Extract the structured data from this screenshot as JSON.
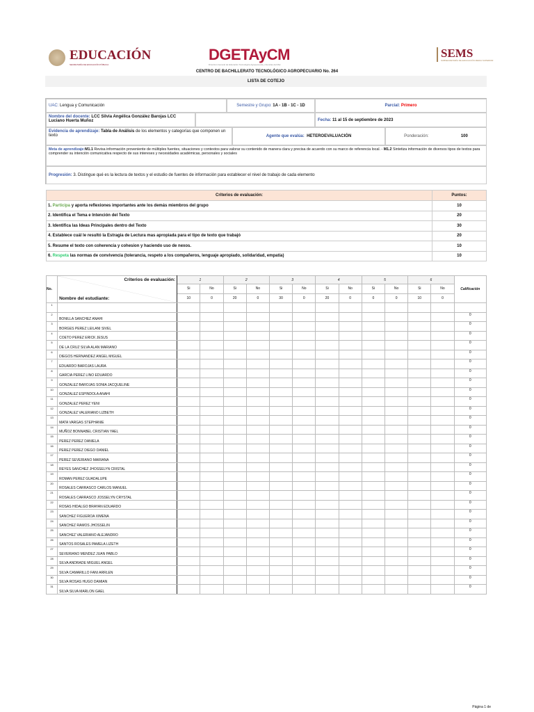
{
  "header": {
    "logo_left": "EDUCACIÓN",
    "logo_left_sub": "SECRETARÍA DE EDUCACIÓN PÚBLICA",
    "logo_center": "DGETAyCM",
    "logo_center_sub": "Dirección General de Educación Tecnológica Agropecuaria y Ciencias del Mar",
    "logo_right": "SEMS",
    "logo_right_sub": "SUBSECRETARÍA DE EDUCACIÓN MEDIA SUPERIOR",
    "school": "CENTRO DE BACHILLERATO TECNOLÓGICO AGROPECUARIO No. 264",
    "doc_title": "LISTA DE COTEJO"
  },
  "info": {
    "uac_label": "UAC:",
    "uac": "Lengua y Comunicación",
    "semestre_label": "Semestre y Grupo:",
    "semestre": "1A - 1B - 1C - 1D",
    "parcial_label": "Parcial:",
    "parcial": "Primero",
    "docente_label": "Nombre del docente:",
    "docente": "LCC Silvia Angélica González Barojas LCC Luciano Huerta Muñoz",
    "fecha_label": "Fecha:",
    "fecha": "11 al 15 de septiembre de 2023",
    "evidencia_label": "Evidencia de aprendizaje:",
    "evidencia_bold": "Tabla de Análisis",
    "evidencia": " de los elementos y categorías que componen un texto",
    "agente_label": "Agente que evalúa:",
    "agente": "HETEROEVALUACIÓN",
    "ponderacion_label": "Ponderación:",
    "ponderacion": "100",
    "meta_label": "Meta de aprendizaje:",
    "meta_m1": "M1.1",
    "meta_text1": " Revisa información proveniente de múltiples fuentes, situaciones y contextos para valorar su contenido de manera clara y precisa de acuerdo con su marco de referencia local. - ",
    "meta_m2": "M1.2",
    "meta_text2": " Sintetiza información de diversos tipos de textos para comprender su intención comunicativa respecto de sus intereses y necesidades académicas, personales y sociales",
    "progresion_label": "Progresión:",
    "progresion": "3. Distingue qué es la lectura de textos y el estudio de fuentes de información para establecer el nivel de trabajo de cada elemento"
  },
  "criteria": {
    "header": "Criterios de evaluación:",
    "points_header": "Puntos:",
    "items": [
      {
        "num": "1. ",
        "hl": "Participa",
        "text": " y aporta reflexiones importantes ante los demás miembros del grupo",
        "points": "10"
      },
      {
        "num": "",
        "hl": "",
        "text": "2. Identifica el Tema e Intención del Texto",
        "points": "20"
      },
      {
        "num": "",
        "hl": "",
        "text": "3. Identifica las Ideas Principales dentro del Texto",
        "points": "30"
      },
      {
        "num": "",
        "hl": "",
        "text": "4. Establece cuál le resultó la Estragia de Lectura mas apropiada para el tipo de texto que trabajó",
        "points": "20"
      },
      {
        "num": "",
        "hl": "",
        "text": "5. Resume el texto con coherencia y cohesion y haciendo uso de nexos.",
        "points": "10"
      },
      {
        "num": "6. ",
        "hl": "Respeta",
        "text": " las normas de convivencia (tolerancia, respeto a los compañeros, lenguaje apropiado, solidaridad, empatía)",
        "points": "10"
      }
    ]
  },
  "grid": {
    "no_header": "No.",
    "criteria_header": "Criterios de evaluación:",
    "student_header": "Nombre del estudiante:",
    "grade_header": "Calificación",
    "groups": [
      "1",
      "2",
      "3",
      "4",
      "5",
      "6"
    ],
    "si": "Si",
    "no": "No",
    "weights": [
      "10",
      "0",
      "20",
      "0",
      "30",
      "0",
      "20",
      "0",
      "0",
      "0",
      "10",
      "0"
    ],
    "students": [
      {
        "n": "1",
        "name": "",
        "grade": ""
      },
      {
        "n": "2",
        "name": "BONILLA SANCHEZ ANAHI",
        "grade": "0"
      },
      {
        "n": "3",
        "name": "BORGES PEREZ LEILANI SIVEL",
        "grade": "0"
      },
      {
        "n": "4",
        "name": "COETO PEREZ ERICK JESUS",
        "grade": "0"
      },
      {
        "n": "5",
        "name": "DE LA CRUZ SILVA ALAN MARIANO",
        "grade": "0"
      },
      {
        "n": "6",
        "name": "DIEGOS HERNANDEZ ANGEL MIGUEL",
        "grade": "0"
      },
      {
        "n": "7",
        "name": "EDUARDO BAROJAS LAURA",
        "grade": "0"
      },
      {
        "n": "8",
        "name": "GARCIA PEREZ LINO EDUARDO",
        "grade": "0"
      },
      {
        "n": "9",
        "name": "GONZALEZ BAROJAS SONIA JACQUELINE",
        "grade": "0"
      },
      {
        "n": "10",
        "name": "GONZALEZ ESPINDOLA ANAHI",
        "grade": "0"
      },
      {
        "n": "11",
        "name": "GONZALEZ PEREZ YENI",
        "grade": "0"
      },
      {
        "n": "12",
        "name": "GONZALEZ VALERIANO LIZBETH",
        "grade": "0"
      },
      {
        "n": "13",
        "name": "MATA VARGAS STEPHANIE",
        "grade": "0"
      },
      {
        "n": "14",
        "name": "MUÑOZ BONNABEL CRISTIAN YAEL",
        "grade": "0"
      },
      {
        "n": "15",
        "name": "PEREZ PEREZ DANIELA",
        "grade": "0"
      },
      {
        "n": "16",
        "name": "PEREZ PEREZ DIEGO DANIEL",
        "grade": "0"
      },
      {
        "n": "17",
        "name": "PEREZ SEVERIANO MARIANA",
        "grade": "0"
      },
      {
        "n": "18",
        "name": "REYES SANCHEZ JHOSSELYN CRISTAL",
        "grade": "0"
      },
      {
        "n": "19",
        "name": "ROMAN PEREZ GUADALUPE",
        "grade": "0"
      },
      {
        "n": "20",
        "name": "ROSALES CARRASCO CARLOS MANUEL",
        "grade": "0"
      },
      {
        "n": "21",
        "name": "ROSALES CARRASCO JOSSELYN CRYSTAL",
        "grade": "0"
      },
      {
        "n": "22",
        "name": "ROSAS HIDALGO BRAYAN EDUARDO",
        "grade": "0"
      },
      {
        "n": "23",
        "name": "SANCHEZ FIGUEROA XIMENA",
        "grade": "0"
      },
      {
        "n": "24",
        "name": "SANCHEZ RAMOS JHOSSELIN",
        "grade": "0"
      },
      {
        "n": "25",
        "name": "SANCHEZ VALERIANO ALEJANDRO",
        "grade": "0"
      },
      {
        "n": "26",
        "name": "SANTOS ROSALES PAMELA LIZETH",
        "grade": "0"
      },
      {
        "n": "27",
        "name": "SEVERIANO MENDEZ JUAN PABLO",
        "grade": "0"
      },
      {
        "n": "28",
        "name": "SILVA ANDRADE MIGUEL ANGEL",
        "grade": "0"
      },
      {
        "n": "29",
        "name": "SILVA CAMARILLO FANI ARRLEN",
        "grade": "0"
      },
      {
        "n": "30",
        "name": "SILVA ROSAS HUGO DAMIAN",
        "grade": "0"
      },
      {
        "n": "31",
        "name": "SILVA SILVA MARLON GAEL",
        "grade": "0"
      }
    ]
  },
  "footer": "Página 1 de"
}
